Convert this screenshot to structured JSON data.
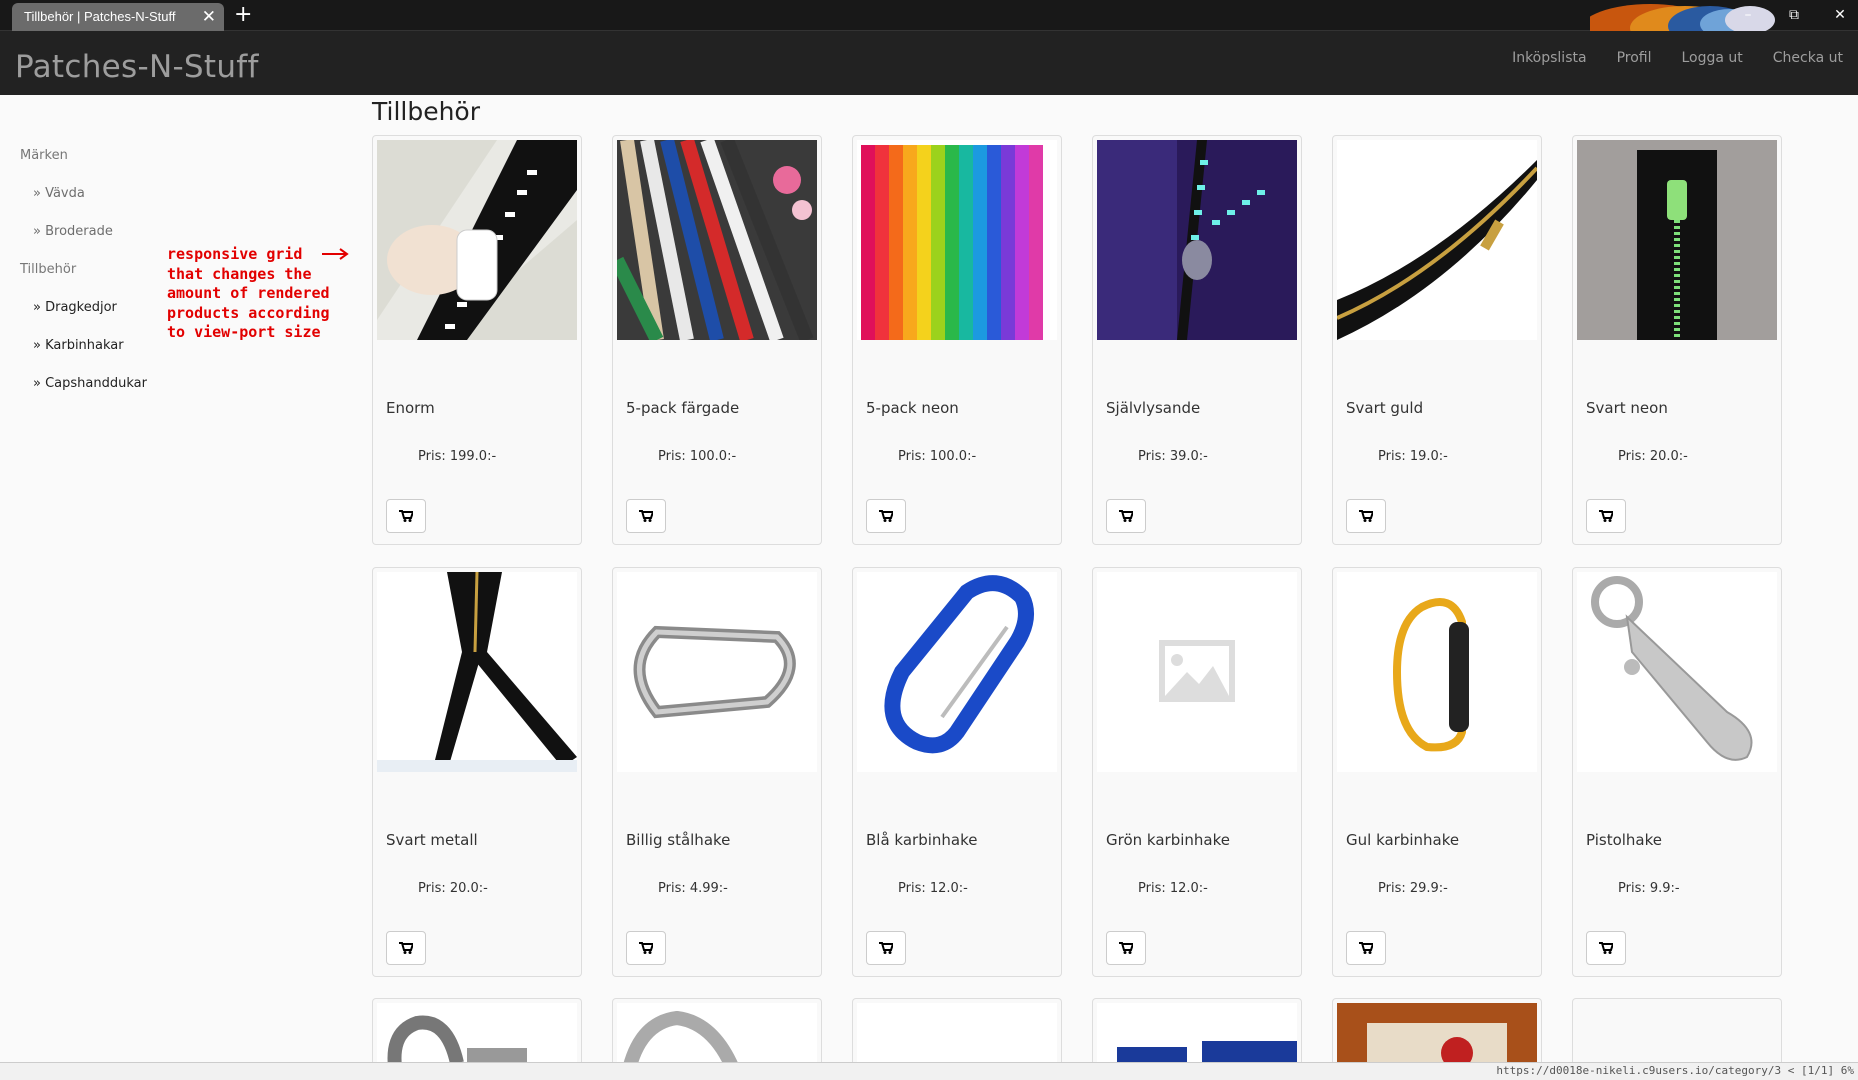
{
  "browser": {
    "tab_title": "Tillbehör | Patches-N-Stuff",
    "tab_close": "✕",
    "new_tab": "+",
    "status_url": "https://d0018e-nikeli.c9users.io/category/3 < [1/1]  6%"
  },
  "header": {
    "brand": "Patches-N-Stuff",
    "nav": [
      "Inköpslista",
      "Profil",
      "Logga ut",
      "Checka ut"
    ]
  },
  "sidebar": {
    "cat1": "Märken",
    "cat1_items": [
      "» Vävda",
      "» Broderade"
    ],
    "cat2": "Tillbehör",
    "cat2_items": [
      "» Dragkedjor",
      "» Karbinhakar",
      "» Capshanddukar"
    ]
  },
  "annotation": "responsive grid\nthat changes the\namount of rendered\nproducts according\nto view-port size",
  "page_title": "Tillbehör",
  "products": [
    {
      "name": "Enorm",
      "price": "Pris: 199.0:-",
      "image": "zipper-hand"
    },
    {
      "name": "5-pack färgade",
      "price": "Pris: 100.0:-",
      "image": "zippers-colored"
    },
    {
      "name": "5-pack neon",
      "price": "Pris: 100.0:-",
      "image": "zippers-rainbow"
    },
    {
      "name": "Självlysande",
      "price": "Pris: 39.0:-",
      "image": "zipper-glow"
    },
    {
      "name": "Svart guld",
      "price": "Pris: 19.0:-",
      "image": "zipper-black-gold"
    },
    {
      "name": "Svart neon",
      "price": "Pris: 20.0:-",
      "image": "zipper-black-neon"
    },
    {
      "name": "Svart metall",
      "price": "Pris: 20.0:-",
      "image": "zipper-black-metal"
    },
    {
      "name": "Billig stålhake",
      "price": "Pris: 4.99:-",
      "image": "carabiner-steel"
    },
    {
      "name": "Blå karbinhake",
      "price": "Pris: 12.0:-",
      "image": "carabiner-blue"
    },
    {
      "name": "Grön karbinhake",
      "price": "Pris: 12.0:-",
      "image": "image-placeholder"
    },
    {
      "name": "Gul karbinhake",
      "price": "Pris: 29.9:-",
      "image": "carabiner-yellow"
    },
    {
      "name": "Pistolhake",
      "price": "Pris: 9.9:-",
      "image": "snap-hook"
    }
  ],
  "colors": {
    "accent_red": "#e20000",
    "header_bg": "#222222",
    "nav_text": "#9d9d9d"
  }
}
